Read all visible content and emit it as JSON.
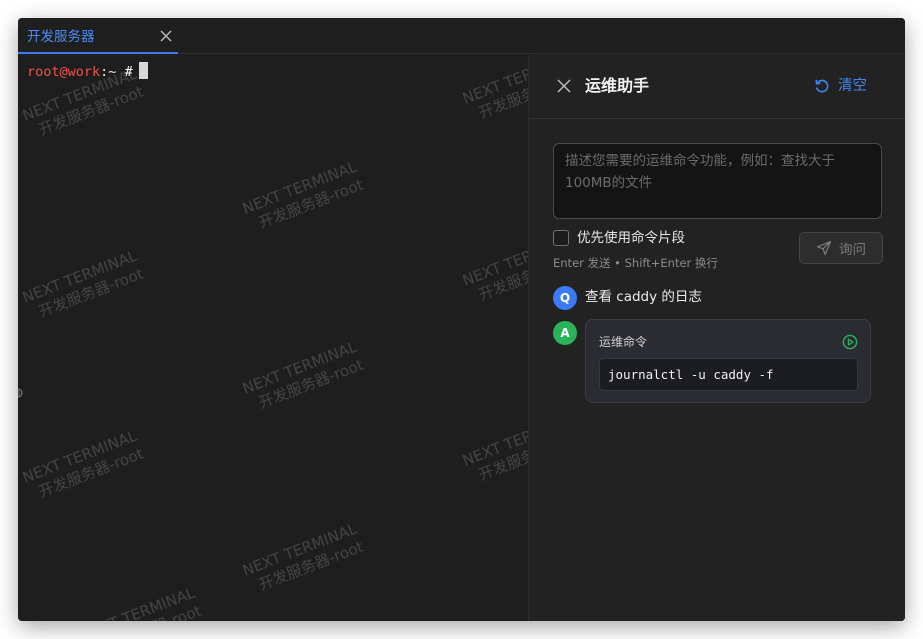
{
  "tab": {
    "label": "开发服务器"
  },
  "terminal": {
    "user_host": "root@work",
    "path": ":~",
    "symbol": "#"
  },
  "watermark": {
    "line1": "NEXT TERMINAL",
    "line2": "开发服务器-root"
  },
  "assistant": {
    "title": "运维助手",
    "clear_label": "清空",
    "query_placeholder": "描述您需要的运维命令功能，例如：查找大于100MB的文件",
    "prefer_snippets_label": "优先使用命令片段",
    "hint": "Enter 发送 • Shift+Enter 换行",
    "ask_label": "询问",
    "question_badge": "Q",
    "answer_badge": "A",
    "question": "查看 caddy 的日志",
    "answer_label": "运维命令",
    "command": "journalctl -u caddy -f"
  },
  "colors": {
    "accent": "#3f86f5",
    "prompt_user": "#f0514a",
    "answer_badge": "#2ab45a",
    "question_badge": "#3b7cf5"
  }
}
